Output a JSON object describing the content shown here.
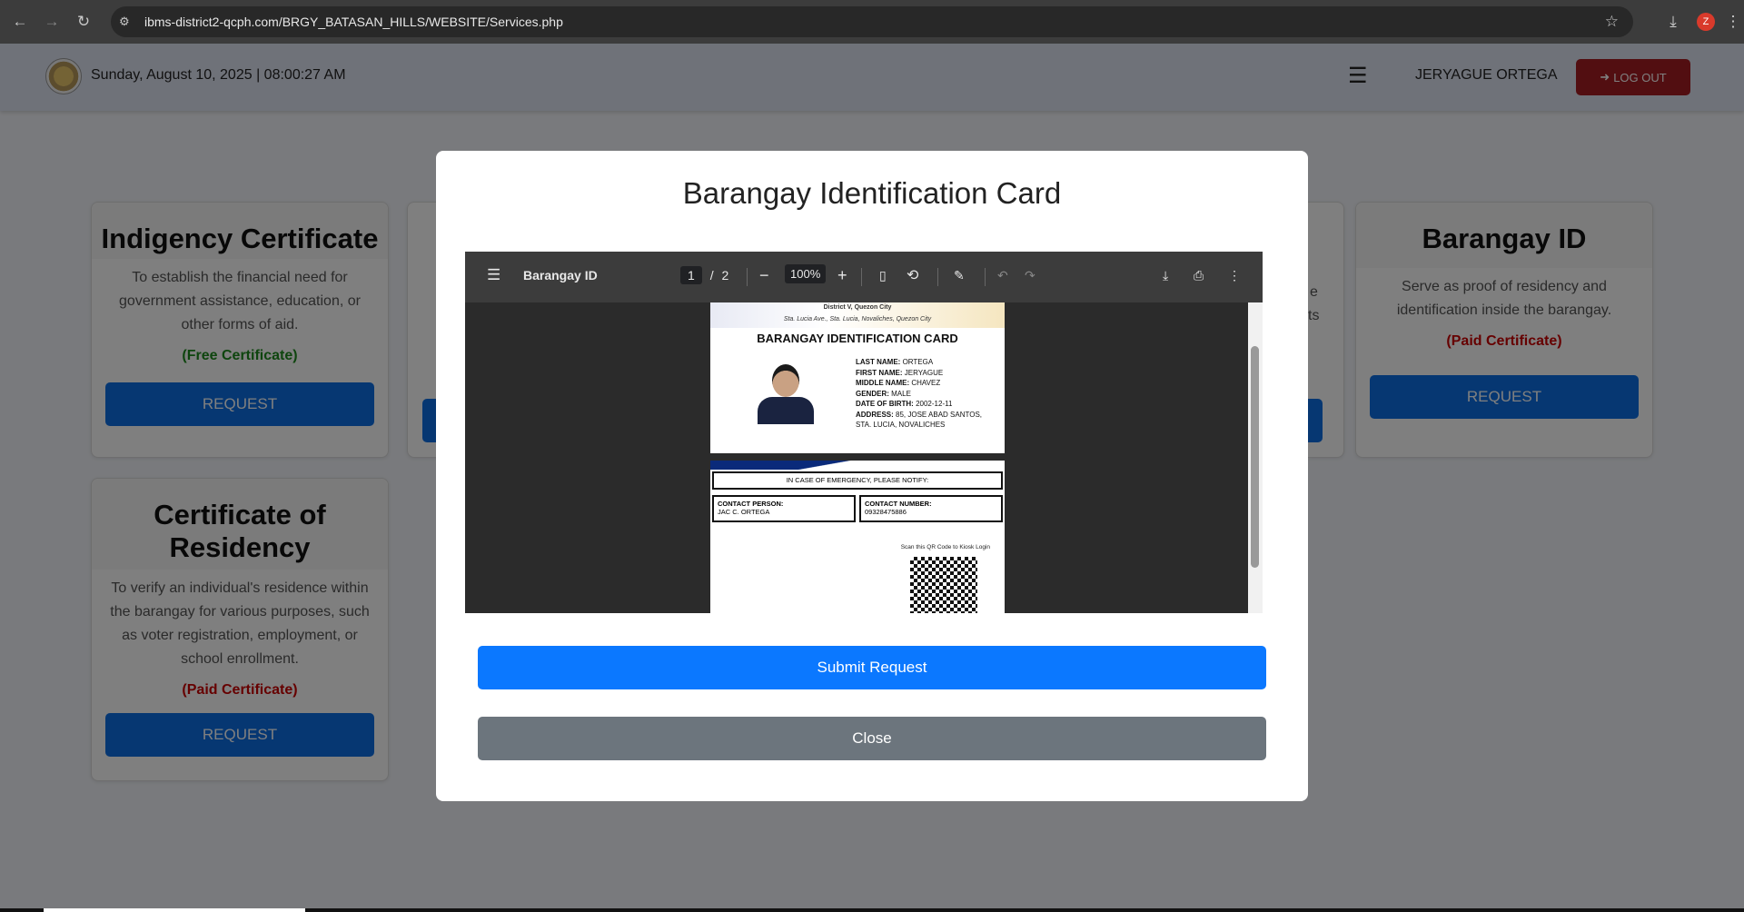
{
  "browser": {
    "url": "ibms-district2-qcph.com/BRGY_BATASAN_HILLS/WEBSITE/Services.php",
    "profile_initial": "Z"
  },
  "header": {
    "datetime": "Sunday, August 10, 2025 | 08:00:27 AM",
    "username": "JERYAGUE ORTEGA",
    "logout_label": "LOG OUT"
  },
  "cards": {
    "indigency": {
      "title": "Indigency Certificate",
      "description": "To establish the financial need for government assistance, education, or other forms of aid.",
      "tag": "(Free Certificate)",
      "button": "REQUEST"
    },
    "residency": {
      "title": "Certificate of Residency",
      "description": "To verify an individual's residence within the barangay for various purposes, such as voter registration, employment, or school enrollment.",
      "tag": "(Paid Certificate)",
      "button": "REQUEST"
    },
    "barangay_id": {
      "title": "Barangay ID",
      "description": "Serve as proof of residency and identification inside the barangay.",
      "tag": "(Paid Certificate)",
      "button": "REQUEST"
    },
    "partial_right_text_1": "e",
    "partial_right_text_2": "ts"
  },
  "modal": {
    "title": "Barangay Identification Card",
    "submit_label": "Submit Request",
    "close_label": "Close"
  },
  "pdf_viewer": {
    "doc_title": "Barangay ID",
    "current_page": "1",
    "page_separator": "/",
    "total_pages": "2",
    "zoom": "100%"
  },
  "id_card": {
    "header_line1": "District V, Quezon City",
    "header_line2": "Sta. Lucia Ave., Sta. Lucia, Novaliches, Quezon City",
    "card_title": "BARANGAY IDENTIFICATION CARD",
    "last_name_label": "LAST NAME:",
    "last_name": "ORTEGA",
    "first_name_label": "FIRST NAME:",
    "first_name": "JERYAGUE",
    "middle_name_label": "MIDDLE NAME:",
    "middle_name": "CHAVEZ",
    "gender_label": "GENDER:",
    "gender": "MALE",
    "dob_label": "DATE OF BIRTH:",
    "dob": "2002-12-11",
    "address_label": "ADDRESS:",
    "address_line1": "85, JOSE ABAD SANTOS,",
    "address_line2": "STA. LUCIA, NOVALICHES",
    "emergency_label": "IN CASE OF EMERGENCY, PLEASE NOTIFY:",
    "contact_person_label": "CONTACT PERSON:",
    "contact_person": "JAC C. ORTEGA",
    "contact_number_label": "CONTACT NUMBER:",
    "contact_number": "09328475886",
    "qr_caption": "Scan this QR Code to Kiosk Login"
  }
}
